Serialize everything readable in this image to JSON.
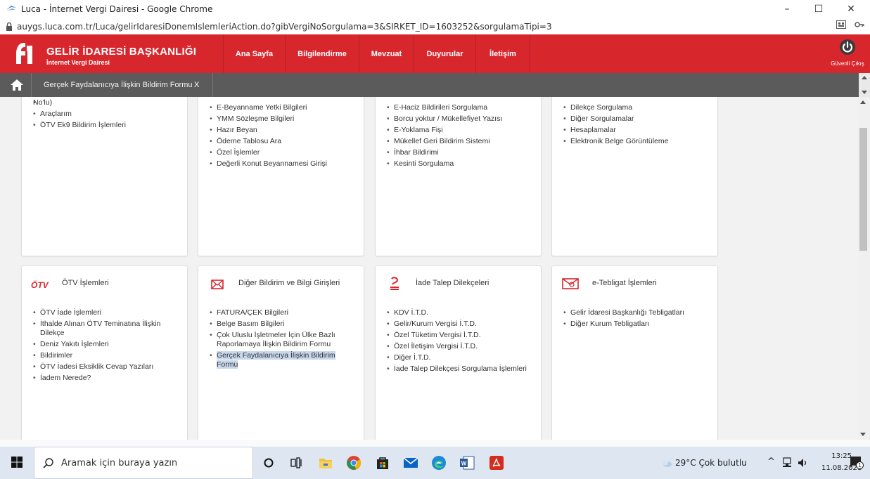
{
  "window": {
    "title": "Luca - İnternet Vergi Dairesi - Google Chrome",
    "url": "auygs.luca.com.tr/Luca/gelirIdaresiDonemIslemleriAction.do?gibVergiNoSorgulama=3&SIRKET_ID=1603252&sorgulamaTipi=3",
    "minimize": "–",
    "maximize": "☐",
    "close": "✕"
  },
  "header": {
    "brand_title": "GELİR İDARESİ BAŞKANLIĞI",
    "brand_subtitle": "İnternet Vergi Dairesi",
    "nav": [
      "Ana Sayfa",
      "Bilgilendirme",
      "Mevzuat",
      "Duyurular",
      "İletişim"
    ],
    "exit_label": "Güvenli Çıkış",
    "colors": {
      "red": "#d8262d",
      "tab_strip": "#5b5b5b"
    }
  },
  "tabs": {
    "active_label": "Gerçek Faydalanıcıya İlişkin Bildirim Formu",
    "close": "X"
  },
  "top_cards": [
    {
      "items": [
        "No'lu)",
        "Araçlarım",
        "ÖTV Ek9 Bildirim İşlemleri"
      ]
    },
    {
      "items": [
        "E-Beyanname Yetki Bilgileri",
        "YMM Sözleşme Bilgileri",
        "Hazır Beyan",
        "Ödeme Tablosu Ara",
        "Özel İşlemler",
        "Değerli Konut Beyannamesi Girişi"
      ]
    },
    {
      "items": [
        "E-Haciz Bildirileri Sorgulama",
        "Borcu yoktur / Mükellefiyet Yazısı",
        "E-Yoklama Fişi",
        "Mükellef Geri Bildirim Sistemi",
        "İhbar Bildirimi",
        "Kesinti Sorgulama"
      ]
    },
    {
      "items": [
        "Dilekçe Sorgulama",
        "Diğer Sorgulamalar",
        "Hesaplamalar",
        "Elektronik Belge Görüntüleme"
      ]
    }
  ],
  "bottom_cards": [
    {
      "title": "ÖTV İşlemleri",
      "icon_text": "ÖTV",
      "icon": "otv-icon",
      "items": [
        "ÖTV İade İşlemleri",
        "İthalde Alınan ÖTV Teminatına İlişkin Dilekçe",
        "Deniz Yakıtı İşlemleri",
        "Bildirimler",
        "ÖTV İadesi Eksiklik Cevap Yazıları",
        "İadem Nerede?"
      ]
    },
    {
      "title": "Diğer Bildirim ve Bilgi Girişleri",
      "icon": "envelope-icon",
      "items": [
        "FATURA/ÇEK Bilgileri",
        "Belge Basım Bilgileri",
        "Çok Uluslu İşletmeler İçin Ülke Bazlı Raporlamaya İlişkin Bildirim Formu",
        "Gerçek Faydalanıcıya İlişkin Bildirim Formu"
      ]
    },
    {
      "title": "İade Talep Dilekçeleri",
      "icon": "refund-icon",
      "items": [
        "KDV İ.T.D.",
        "Gelir/Kurum Vergisi İ.T.D.",
        "Özel Tüketim Vergisi İ.T.D.",
        "Özel İletişim Vergisi İ.T.D.",
        "Diğer İ.T.D.",
        "İade Talep Dilekçesi Sorgulama İşlemleri"
      ]
    },
    {
      "title": "e-Tebligat İşlemleri",
      "icon": "e-tebligat-icon",
      "items": [
        "Gelir İdaresi Başkanlığı Tebligatları",
        "Diğer Kurum Tebligatları"
      ]
    }
  ],
  "taskbar": {
    "search_placeholder": "Aramak için buraya yazın",
    "weather": "29°C  Çok bulutlu",
    "time": "13:25",
    "date": "11.08.2021",
    "notification_count": "1"
  }
}
